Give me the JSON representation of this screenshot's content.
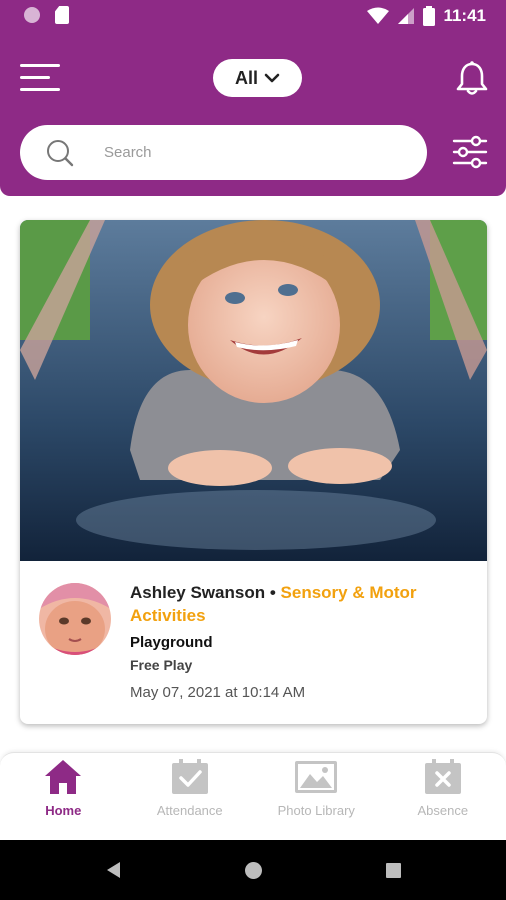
{
  "status_bar": {
    "time": "11:41"
  },
  "header": {
    "filter_label": "All",
    "search": {
      "placeholder": "Search",
      "value": ""
    }
  },
  "feed": [
    {
      "child_name": "Ashley Swanson",
      "separator": "•",
      "activity": "Sensory & Motor Activities",
      "location": "Playground",
      "subtype": "Free Play",
      "timestamp": "May 07, 2021 at 10:14 AM"
    }
  ],
  "bottom_nav": {
    "items": [
      {
        "label": "Home",
        "icon": "home-icon",
        "active": true
      },
      {
        "label": "Attendance",
        "icon": "calendar-check-icon",
        "active": false
      },
      {
        "label": "Photo Library",
        "icon": "image-icon",
        "active": false
      },
      {
        "label": "Absence",
        "icon": "calendar-x-icon",
        "active": false
      }
    ]
  },
  "colors": {
    "brand": "#8e2a86",
    "activity_accent": "#f2a10f",
    "inactive_nav": "#b7b7b7"
  }
}
